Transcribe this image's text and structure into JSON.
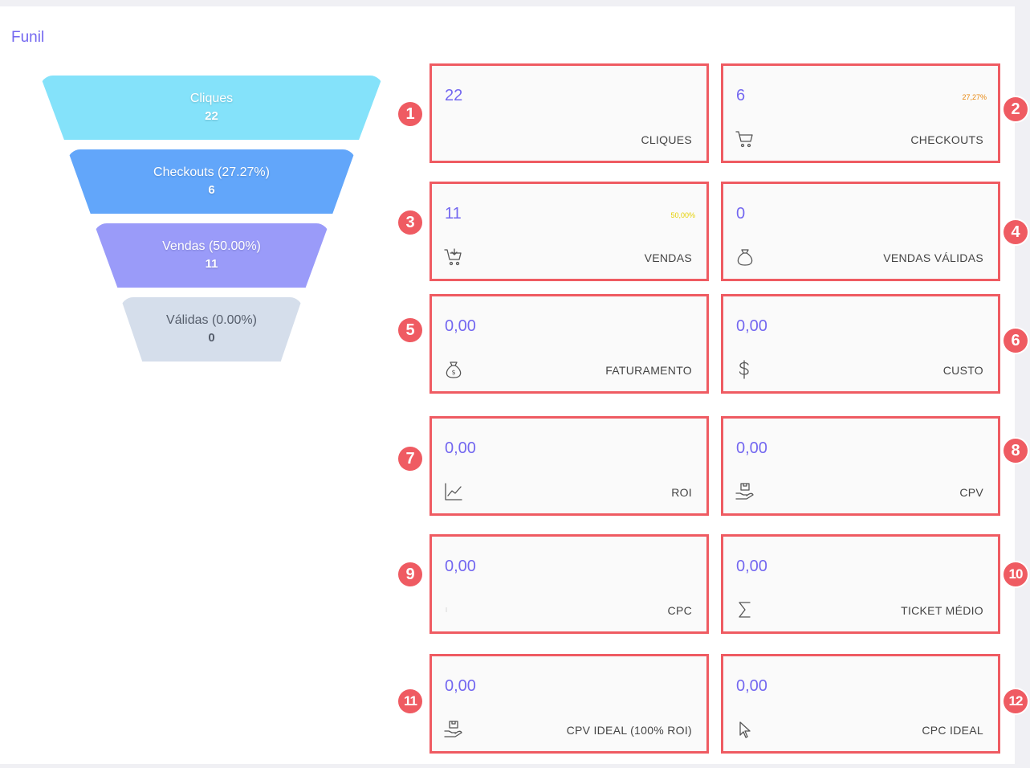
{
  "header": {
    "title": "Funil"
  },
  "funnel": [
    {
      "label": "Cliques",
      "value": "22"
    },
    {
      "label": "Checkouts (27.27%)",
      "value": "6"
    },
    {
      "label": "Vendas (50.00%)",
      "value": "11"
    },
    {
      "label": "Válidas (0.00%)",
      "value": "0"
    }
  ],
  "cards": [
    {
      "value": "22",
      "label": "CLIQUES",
      "badge": "1",
      "icon": "none"
    },
    {
      "value": "6",
      "label": "CHECKOUTS",
      "percent": "27,27%",
      "percent_color": "#e8870e",
      "badge": "2",
      "icon": "cart-icon"
    },
    {
      "value": "11",
      "label": "VENDAS",
      "percent": "50,00%",
      "percent_color": "#e5d000",
      "badge": "3",
      "icon": "cart-download-icon"
    },
    {
      "value": "0",
      "label": "VENDAS VÁLIDAS",
      "badge": "4",
      "icon": "bag-icon"
    },
    {
      "value": "0,00",
      "label": "FATURAMENTO",
      "badge": "5",
      "icon": "money-bag-icon"
    },
    {
      "value": "0,00",
      "label": "CUSTO",
      "badge": "6",
      "icon": "dollar-icon"
    },
    {
      "value": "0,00",
      "label": "ROI",
      "badge": "7",
      "icon": "chart-line-icon"
    },
    {
      "value": "0,00",
      "label": "CPV",
      "badge": "8",
      "icon": "box-hand-icon"
    },
    {
      "value": "0,00",
      "label": "CPC",
      "badge": "9",
      "icon": "cursor-icon-faint"
    },
    {
      "value": "0,00",
      "label": "TICKET MÉDIO",
      "badge": "10",
      "icon": "sigma-icon"
    },
    {
      "value": "0,00",
      "label": "CPV IDEAL (100% ROI)",
      "badge": "11",
      "icon": "box-hand-icon"
    },
    {
      "value": "0,00",
      "label": "CPC IDEAL",
      "badge": "12",
      "icon": "cursor-icon"
    }
  ],
  "colors": {
    "accent": "#7367f0",
    "border": "#ef5b62",
    "funnel": [
      "#84e2fa",
      "#62a6fa",
      "#9a9bf9",
      "#d5deeb"
    ]
  }
}
